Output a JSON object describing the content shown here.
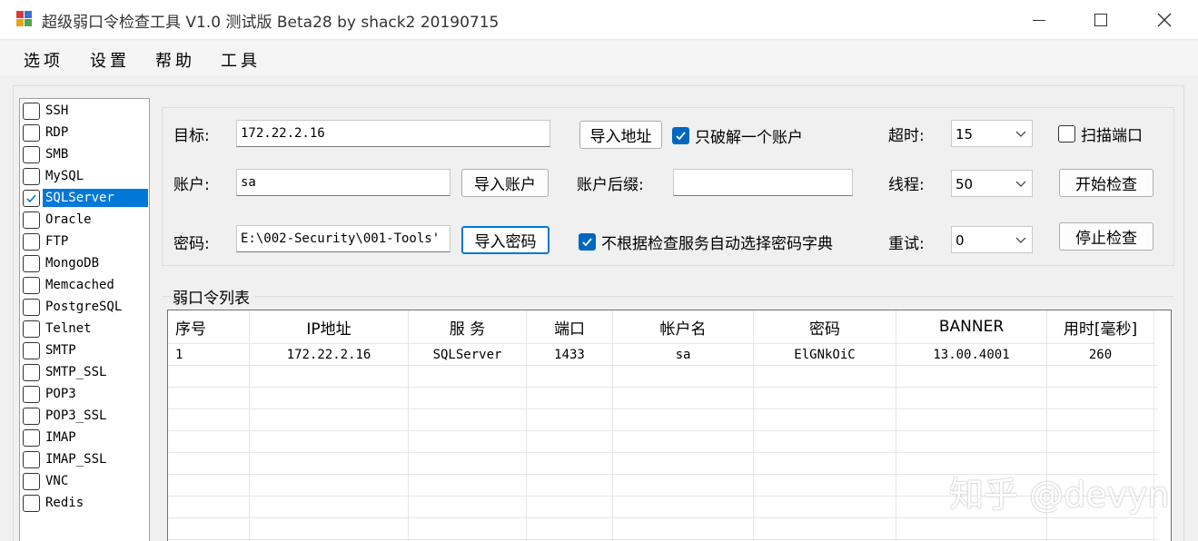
{
  "window": {
    "title": "超级弱口令检查工具 V1.0 测试版 Beta28 by shack2 20190715",
    "minimize_glyph": "—",
    "close_icon": "close-icon"
  },
  "menu": [
    "选项",
    "设置",
    "帮助",
    "工具"
  ],
  "services": [
    {
      "label": "SSH",
      "checked": false
    },
    {
      "label": "RDP",
      "checked": false
    },
    {
      "label": "SMB",
      "checked": false
    },
    {
      "label": "MySQL",
      "checked": false
    },
    {
      "label": "SQLServer",
      "checked": true,
      "selected": true
    },
    {
      "label": "Oracle",
      "checked": false
    },
    {
      "label": "FTP",
      "checked": false
    },
    {
      "label": "MongoDB",
      "checked": false
    },
    {
      "label": "Memcached",
      "checked": false
    },
    {
      "label": "PostgreSQL",
      "checked": false
    },
    {
      "label": "Telnet",
      "checked": false
    },
    {
      "label": "SMTP",
      "checked": false
    },
    {
      "label": "SMTP_SSL",
      "checked": false
    },
    {
      "label": "POP3",
      "checked": false
    },
    {
      "label": "POP3_SSL",
      "checked": false
    },
    {
      "label": "IMAP",
      "checked": false
    },
    {
      "label": "IMAP_SSL",
      "checked": false
    },
    {
      "label": "VNC",
      "checked": false
    },
    {
      "label": "Redis",
      "checked": false
    }
  ],
  "settings": {
    "target_label": "目标:",
    "target_value": "172.22.2.16",
    "import_address_button": "导入地址",
    "only_one_account_label": "只破解一个账户",
    "only_one_account_checked": true,
    "timeout_label": "超时:",
    "timeout_value": "15",
    "scan_port_label": "扫描端口",
    "scan_port_checked": false,
    "account_label": "账户:",
    "account_value": "sa",
    "import_account_button": "导入账户",
    "account_suffix_label": "账户后缀:",
    "account_suffix_value": "",
    "threads_label": "线程:",
    "threads_value": "50",
    "start_button": "开始检查",
    "password_label": "密码:",
    "password_value": "E:\\002-Security\\001-Tools'",
    "import_password_button": "导入密码",
    "auto_dict_label": "不根据检查服务自动选择密码字典",
    "auto_dict_checked": true,
    "retry_label": "重试:",
    "retry_value": "0",
    "stop_button": "停止检查"
  },
  "results": {
    "group_title": "弱口令列表",
    "columns": [
      "序号",
      "IP地址",
      "服 务",
      "端口",
      "帐户名",
      "密码",
      "BANNER",
      "用时[毫秒]"
    ],
    "rows": [
      [
        "1",
        "172.22.2.16",
        "SQLServer",
        "1433",
        "sa",
        "ElGNkOiC",
        "13.00.4001",
        "260"
      ]
    ]
  },
  "watermark": "知乎 @devyn"
}
